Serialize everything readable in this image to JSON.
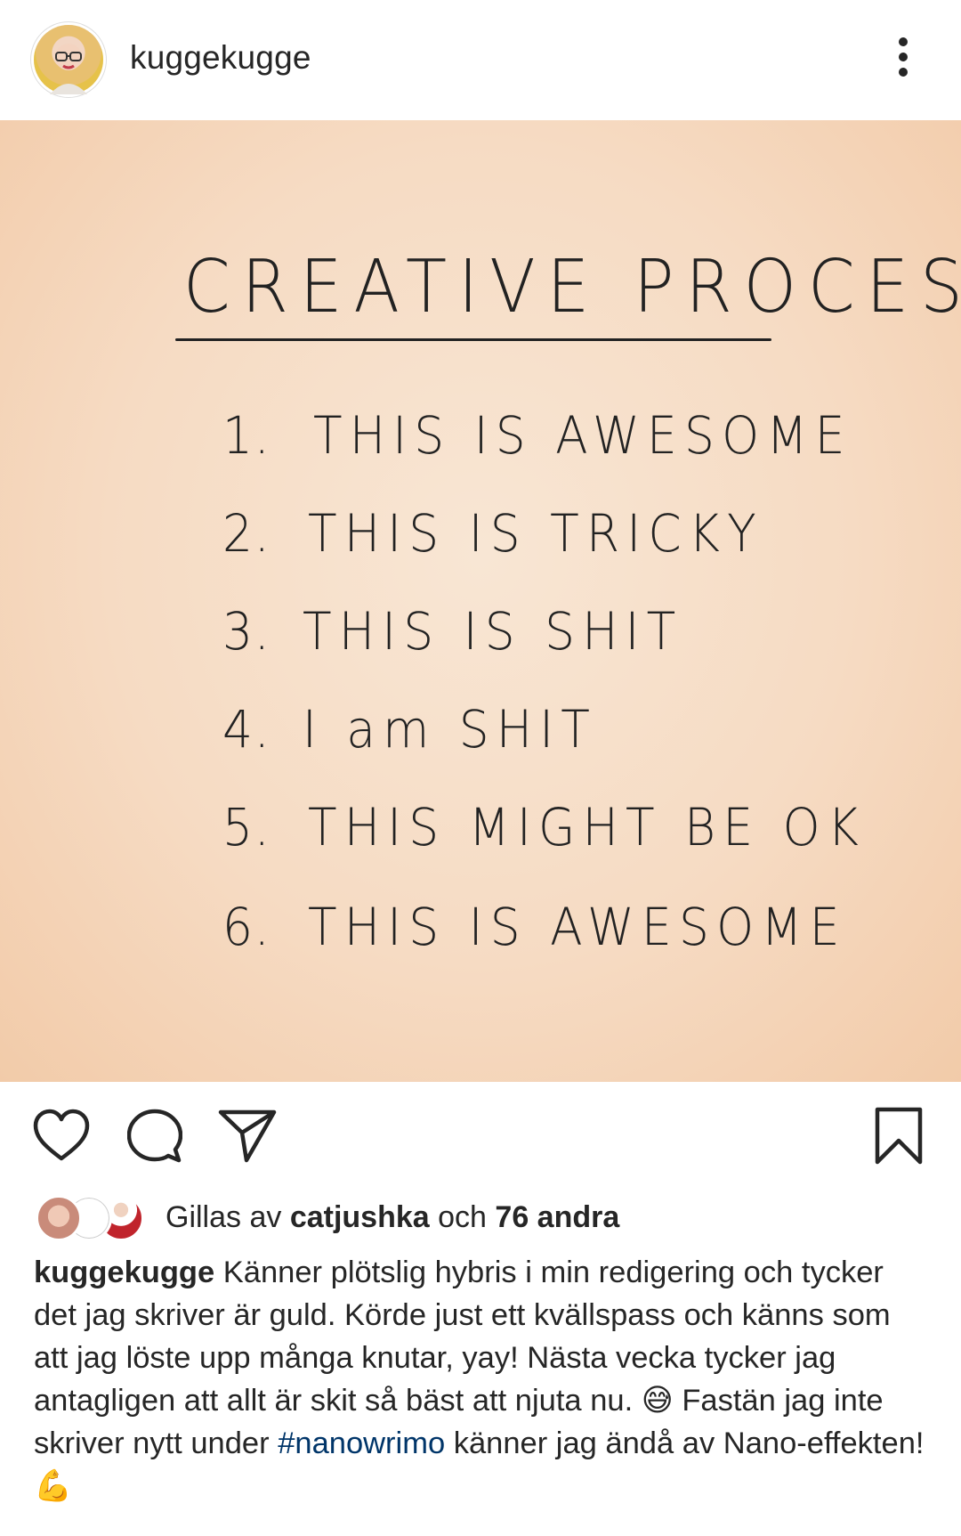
{
  "post": {
    "username": "kuggekugge",
    "image": {
      "title": "CREATIVE PROCESS",
      "items": [
        {
          "num": "1.",
          "text": "THIS IS AWESOME"
        },
        {
          "num": "2.",
          "text": "THIS IS TRICKY"
        },
        {
          "num": "3.",
          "text": "THIS IS SHIT"
        },
        {
          "num": "4.",
          "text": "I am SHIT"
        },
        {
          "num": "5.",
          "text": "THIS MIGHT BE OK"
        },
        {
          "num": "6.",
          "text": "THIS IS AWESOME"
        }
      ]
    },
    "icons": {
      "more": "more-vertical-icon",
      "like": "heart-icon",
      "comment": "comment-icon",
      "share": "send-icon",
      "save": "bookmark-icon"
    },
    "likes": {
      "prefix": "Gillas av",
      "liker": "catjushka",
      "conjunction": "och",
      "others": "76 andra"
    },
    "caption": {
      "username": "kuggekugge",
      "text_part1": "Känner plötslig hybris i min redigering och tycker det jag skriver är guld. Körde just ett kvällspass och känns som att jag löste upp många knutar, yay! Nästa vecka tycker jag antagligen att allt är skit så bäst att njuta nu.",
      "emoji1": "😅",
      "text_part2": "Fastän jag inte skriver nytt under",
      "hashtag": "#nanowrimo",
      "text_part3": "känner jag ändå av Nano-effekten!",
      "emoji2": "💪"
    },
    "colors": {
      "text": "#262626",
      "hashtag": "#003569",
      "image_bg": "#f6dbc3"
    }
  }
}
